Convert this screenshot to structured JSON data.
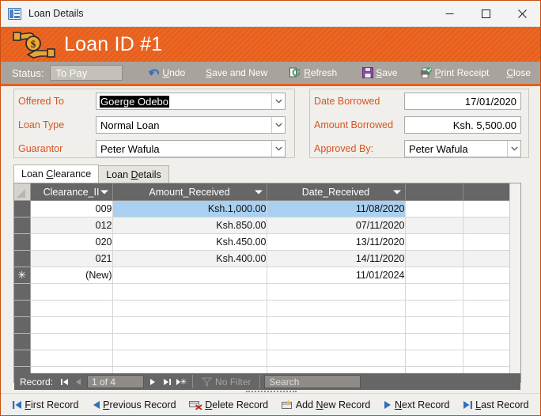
{
  "window": {
    "title": "Loan Details",
    "icon": "access-form-icon",
    "controls": {
      "minimize": "minimize-icon",
      "maximize": "maximize-icon",
      "close": "close-icon"
    }
  },
  "banner": {
    "icon": "loan-money-hand-icon",
    "title": "Loan ID #1",
    "color": "#e8601c"
  },
  "commandbar": {
    "status_label": "Status:",
    "status_value": "To Pay",
    "buttons": [
      {
        "label": "Undo",
        "accel": "U",
        "icon": "undo-arrow-icon"
      },
      {
        "label": "Save and New",
        "accel": "S",
        "icon": ""
      },
      {
        "label": "Refresh",
        "accel": "R",
        "icon": "refresh-icon"
      },
      {
        "label": "Save",
        "accel": "S",
        "icon": "save-floppy-icon"
      },
      {
        "label": "Print Receipt",
        "accel": "P",
        "icon": "print-check-icon"
      },
      {
        "label": "Close",
        "accel": "C",
        "icon": ""
      }
    ]
  },
  "form": {
    "left": [
      {
        "label": "Offered To",
        "value": "Goerge Odebo",
        "type": "combobox",
        "selected": true
      },
      {
        "label": "Loan Type",
        "value": "Normal Loan",
        "type": "combobox",
        "selected": false
      },
      {
        "label": "Guarantor",
        "value": "Peter Wafula",
        "type": "combobox",
        "selected": false
      }
    ],
    "right": [
      {
        "label": "Date Borrowed",
        "value": "17/01/2020",
        "type": "textbox",
        "align": "right"
      },
      {
        "label": "Amount Borrowed",
        "value": "Ksh. 5,500.00",
        "type": "textbox",
        "align": "right"
      },
      {
        "label": "Approved By:",
        "value": "Peter Wafula",
        "type": "combobox",
        "align": "left"
      }
    ]
  },
  "tabs": [
    {
      "label": "Loan Clearance",
      "accel": "C",
      "active": true
    },
    {
      "label": "Loan Details",
      "accel": "D",
      "active": false
    }
  ],
  "datasheet": {
    "columns": [
      "Clearance_II",
      "Amount_Received",
      "Date_Received",
      "",
      ""
    ],
    "rows": [
      {
        "cells": [
          "009",
          "Ksh.1,000.00",
          "11/08/2020",
          "",
          ""
        ],
        "selected": true
      },
      {
        "cells": [
          "012",
          "Ksh.850.00",
          "07/11/2020",
          "",
          ""
        ],
        "selected": false
      },
      {
        "cells": [
          "020",
          "Ksh.450.00",
          "13/11/2020",
          "",
          ""
        ],
        "selected": false
      },
      {
        "cells": [
          "021",
          "Ksh.400.00",
          "14/11/2020",
          "",
          ""
        ],
        "selected": false
      },
      {
        "cells": [
          "(New)",
          "",
          "11/01/2024",
          "",
          ""
        ],
        "selected": false,
        "is_new": true
      }
    ],
    "new_row_marker": "✳"
  },
  "navigator": {
    "label": "Record:",
    "position": "1 of 4",
    "first_icon": "first-record-icon",
    "prev_icon": "previous-record-icon",
    "next_icon": "next-record-icon",
    "last_icon": "last-record-icon",
    "new_icon": "new-record-icon",
    "filter_label": "No Filter",
    "filter_icon": "filter-icon",
    "search_placeholder": "Search"
  },
  "bottom_nav": [
    {
      "label": "First Record",
      "accel": "F",
      "icon": "first-record-icon"
    },
    {
      "label": "Previous Record",
      "accel": "P",
      "icon": "previous-record-icon"
    },
    {
      "label": "Delete Record",
      "accel": "D",
      "icon": "delete-record-icon"
    },
    {
      "label": "Add New Record",
      "accel": "N",
      "icon": "add-record-icon"
    },
    {
      "label": "Next Record",
      "accel": "N",
      "icon": "next-record-icon"
    },
    {
      "label": "Last Record",
      "accel": "L",
      "icon": "last-record-icon"
    }
  ]
}
